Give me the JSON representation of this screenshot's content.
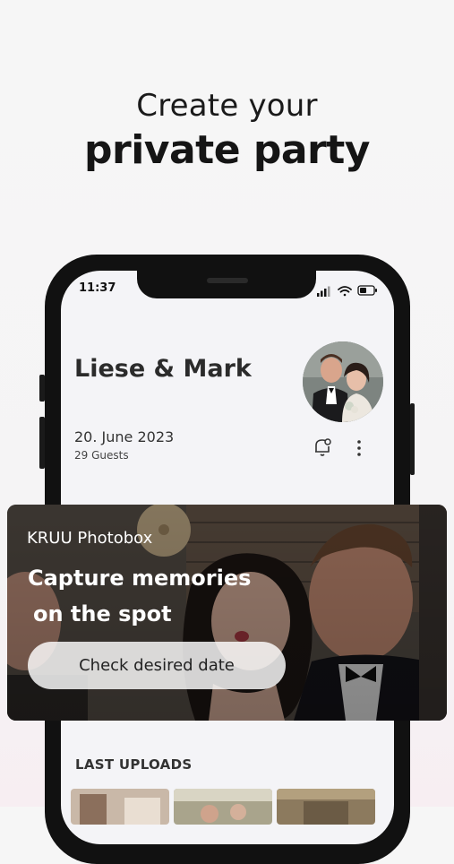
{
  "headline": {
    "line1": "Create your",
    "line2": "private party"
  },
  "status_bar": {
    "time": "11:37",
    "icons": [
      "signal-icon",
      "wifi-icon",
      "battery-icon"
    ]
  },
  "event": {
    "title": "Liese & Mark",
    "date": "20. June 2023",
    "guests": "29 Guests"
  },
  "actions": {
    "icons": [
      "bell-icon",
      "more-vertical-icon"
    ]
  },
  "promo": {
    "brand": "KRUU Photobox",
    "headline_line1": "Capture memories",
    "headline_line2": "on the spot",
    "button_label": "Check desired date"
  },
  "uploads": {
    "section_title": "LAST UPLOADS"
  },
  "colors": {
    "background": "#f6f6f6",
    "phone_frame": "#111111",
    "screen": "#f4f4f7",
    "text_dark": "#1e1e1e"
  }
}
